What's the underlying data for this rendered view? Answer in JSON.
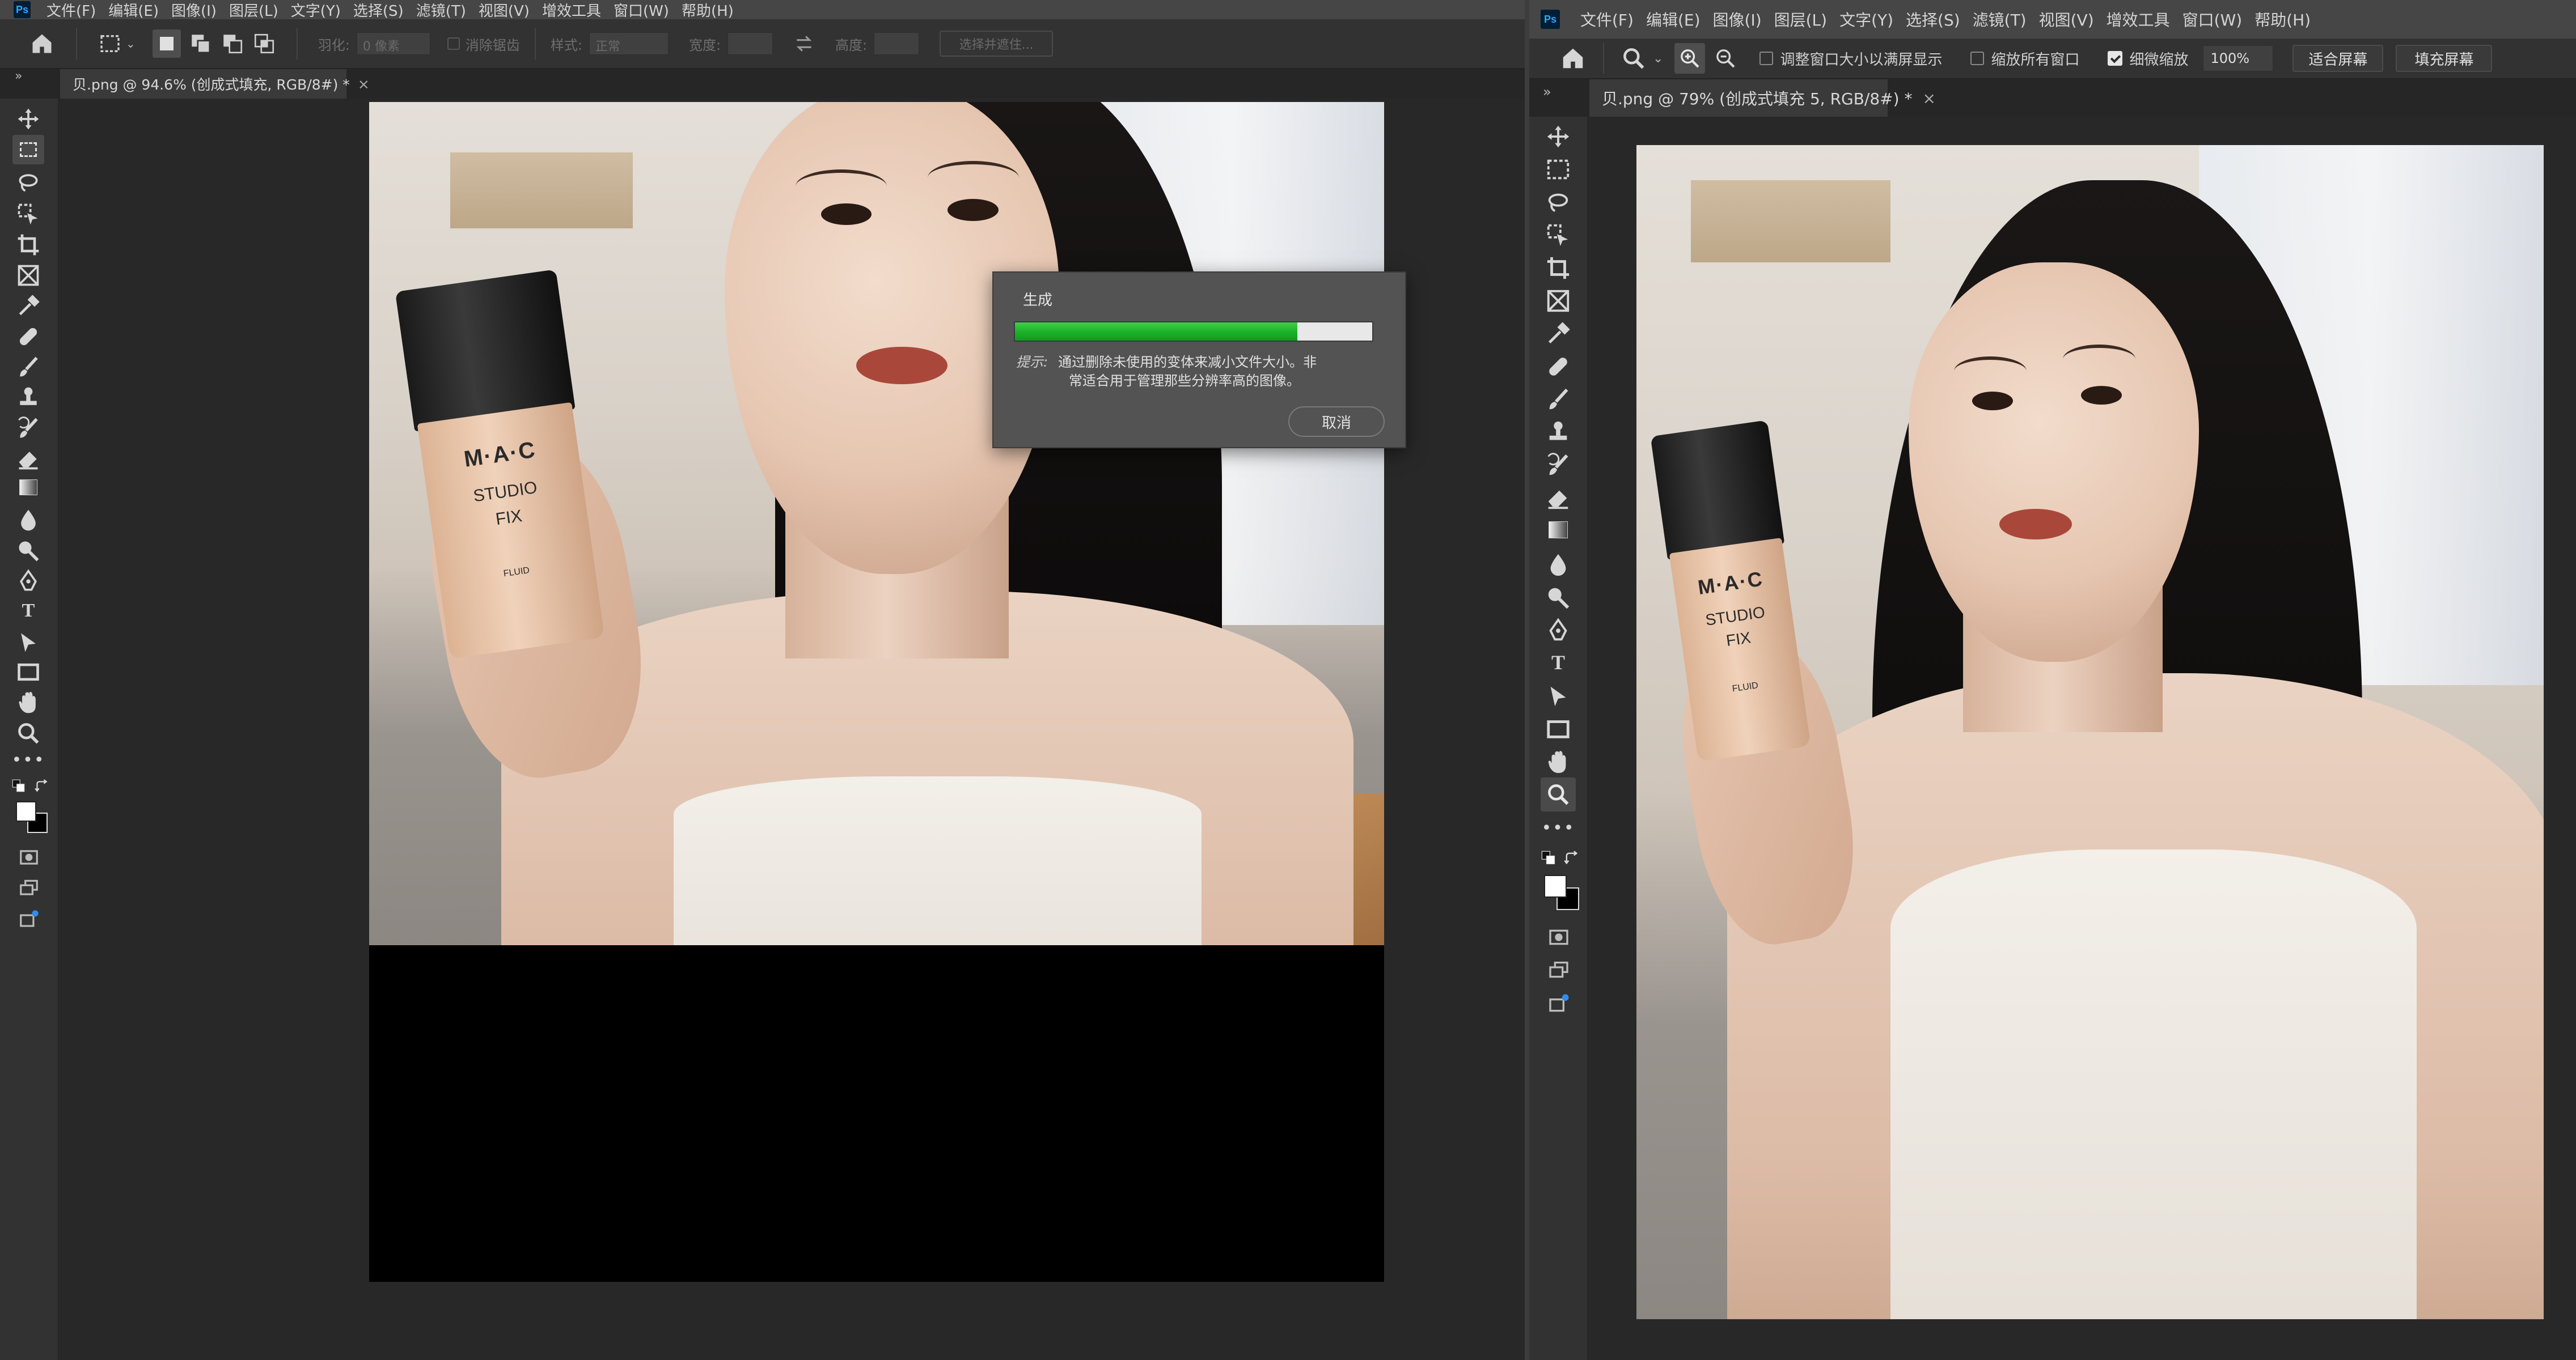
{
  "left_window": {
    "app_logo": "Ps",
    "menu": [
      "文件(F)",
      "编辑(E)",
      "图像(I)",
      "图层(L)",
      "文字(Y)",
      "选择(S)",
      "滤镜(T)",
      "视图(V)",
      "增效工具",
      "窗口(W)",
      "帮助(H)"
    ],
    "options": {
      "feather_label": "羽化:",
      "feather_value": "0 像素",
      "antialias_label": "消除锯齿",
      "style_label": "样式:",
      "style_value": "正常",
      "width_label": "宽度:",
      "height_label": "高度:",
      "select_subject_label": "选择并遮住..."
    },
    "tab_title": "贝.png @ 94.6% (创成式填充, RGB/8#) *",
    "tab_close": "×",
    "dialog": {
      "title": "生成",
      "progress_fraction": 0.79,
      "tip_label": "提示:",
      "tip_line1": "通过删除未使用的变体来减小文件大小。非",
      "tip_line2": "常适合用于管理那些分辨率高的图像。",
      "cancel_label": "取消"
    },
    "bottle_text": {
      "brand": "M·A·C",
      "line1": "STUDIO",
      "line2": "FIX",
      "line3": "FLUID"
    }
  },
  "right_window": {
    "app_logo": "Ps",
    "menu": [
      "文件(F)",
      "编辑(E)",
      "图像(I)",
      "图层(L)",
      "文字(Y)",
      "选择(S)",
      "滤镜(T)",
      "视图(V)",
      "增效工具",
      "窗口(W)",
      "帮助(H)"
    ],
    "options": {
      "resize_windows_label": "调整窗口大小以满屏显示",
      "zoom_all_label": "缩放所有窗口",
      "scrubby_zoom_label": "细微缩放",
      "zoom_value": "100%",
      "fit_screen_label": "适合屏幕",
      "fill_screen_label": "填充屏幕"
    },
    "tab_title": "贝.png @ 79% (创成式填充 5, RGB/8#) *",
    "tab_close": "×",
    "bottle_text": {
      "brand": "M·A·C",
      "line1": "STUDIO",
      "line2": "FIX",
      "line3": "FLUID"
    }
  },
  "colors": {
    "progress_green": "#1db32b",
    "menubar": "#464646",
    "panel": "#323232",
    "canvas_bg": "#282828"
  }
}
